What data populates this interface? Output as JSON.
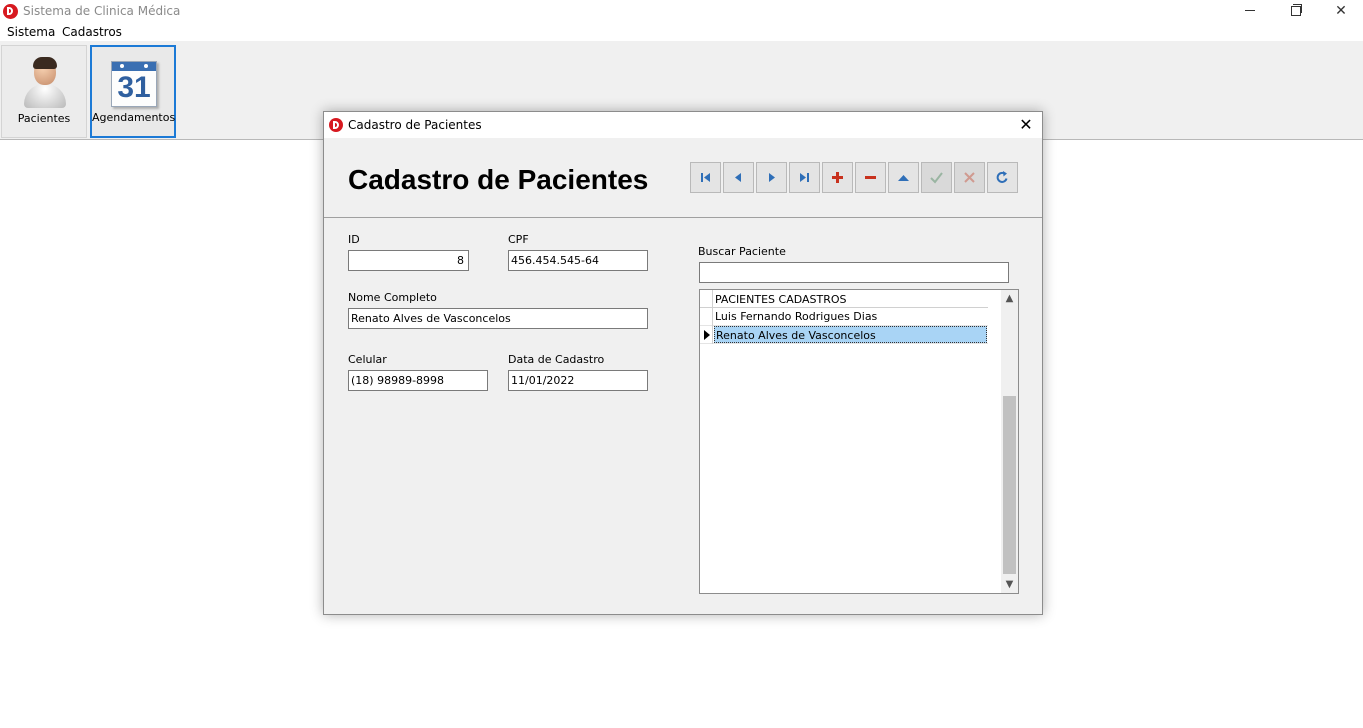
{
  "window": {
    "title": "Sistema de Clinica Médica",
    "minimize": "",
    "maximize": "",
    "close": "✕"
  },
  "menu": [
    "Sistema",
    "Cadastros"
  ],
  "toolbar": {
    "pacientes_label": "Pacientes",
    "agendamentos_label": "Agendamentos",
    "calendar_day": "31"
  },
  "dialog": {
    "title": "Cadastro de Pacientes",
    "close": "✕",
    "heading": "Cadastro de Pacientes",
    "colors": {
      "nav": "#2f6fb8",
      "add_delete": "#c8321e",
      "disabled": "#9aa8b5"
    }
  },
  "form": {
    "id_label": "ID",
    "id_value": "8",
    "cpf_label": "CPF",
    "cpf_value": "456.454.545-64",
    "nome_label": "Nome Completo",
    "nome_value": "Renato Alves de Vasconcelos",
    "celular_label": "Celular",
    "celular_value": "(18) 98989-8998",
    "data_label": "Data de Cadastro",
    "data_value": "11/01/2022"
  },
  "search": {
    "label": "Buscar Paciente",
    "value": ""
  },
  "grid": {
    "header": "PACIENTES CADASTROS",
    "rows": [
      "Luis Fernando Rodrigues Dias",
      "Renato Alves de Vasconcelos"
    ],
    "selected_index": 1
  },
  "scroll": {
    "up": "▲",
    "down": "▼"
  }
}
